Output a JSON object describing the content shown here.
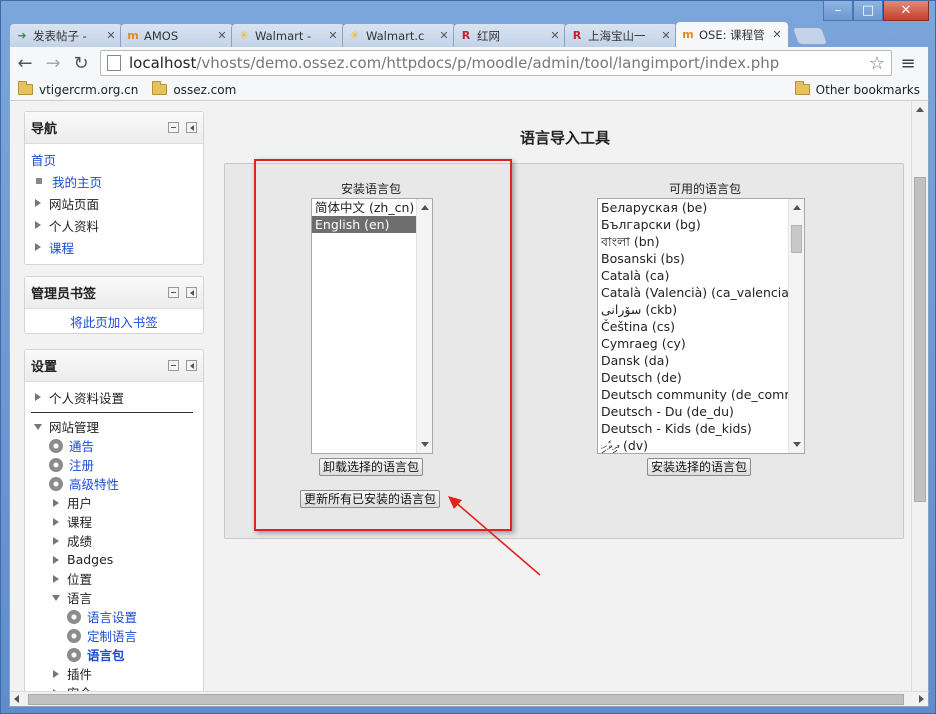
{
  "browser": {
    "tabs": [
      {
        "title": "发表帖子 -",
        "icon": "arrow-favicon"
      },
      {
        "title": "AMOS",
        "icon": "moodle-favicon"
      },
      {
        "title": "Walmart -",
        "icon": "walmart-favicon"
      },
      {
        "title": "Walmart.c",
        "icon": "walmart-favicon"
      },
      {
        "title": "红网",
        "icon": "redmine-favicon"
      },
      {
        "title": "上海宝山一",
        "icon": "redmine-favicon"
      },
      {
        "title": "OSE: 课程管",
        "icon": "moodle-favicon"
      }
    ],
    "url_host": "localhost",
    "url_path": "/vhosts/demo.ossez.com/httpdocs/p/moodle/admin/tool/langimport/index.php",
    "bookmarks": [
      "vtigercrm.org.cn",
      "ossez.com"
    ],
    "other_bookmarks": "Other bookmarks"
  },
  "nav_block": {
    "title": "导航",
    "home": "首页",
    "items": [
      "我的主页",
      "网站页面",
      "个人资料",
      "课程"
    ]
  },
  "admin_bookmarks_block": {
    "title": "管理员书签",
    "link": "将此页加入书签"
  },
  "settings_block": {
    "title": "设置",
    "profile_settings": "个人资料设置",
    "site_admin": "网站管理",
    "site_admin_items": {
      "notifications": "通告",
      "registration": "注册",
      "advanced_features": "高级特性",
      "users": "用户",
      "courses": "课程",
      "grades": "成绩",
      "badges": "Badges",
      "location": "位置",
      "language": "语言",
      "language_settings": "语言设置",
      "language_customisation": "定制语言",
      "language_packs": "语言包",
      "plugins": "插件",
      "security": "安全"
    }
  },
  "main": {
    "page_title": "语言导入工具",
    "installed": {
      "label": "安装语言包",
      "options": [
        "简体中文 (zh_cn)",
        "English (en)"
      ],
      "selected_index": 1,
      "uninstall_button": "卸载选择的语言包",
      "update_button": "更新所有已安装的语言包"
    },
    "available": {
      "label": "可用的语言包",
      "options": [
        "Беларуская (be)",
        "Български (bg)",
        "বাংলা (bn)",
        "Bosanski (bs)",
        "Català (ca)",
        "Català (Valencià) (ca_valencia)",
        "سۆرانی (ckb)",
        "Čeština (cs)",
        "Cymraeg (cy)",
        "Dansk (da)",
        "Deutsch (de)",
        "Deutsch community (de_comm)",
        "Deutsch - Du (de_du)",
        "Deutsch - Kids (de_kids)",
        "ދިވެހި (dv)"
      ],
      "install_button": "安装选择的语言包"
    }
  },
  "colors": {
    "link": "#1a4cd6",
    "highlight_border": "#e0231d",
    "selected_option": "#6e6e6e"
  }
}
